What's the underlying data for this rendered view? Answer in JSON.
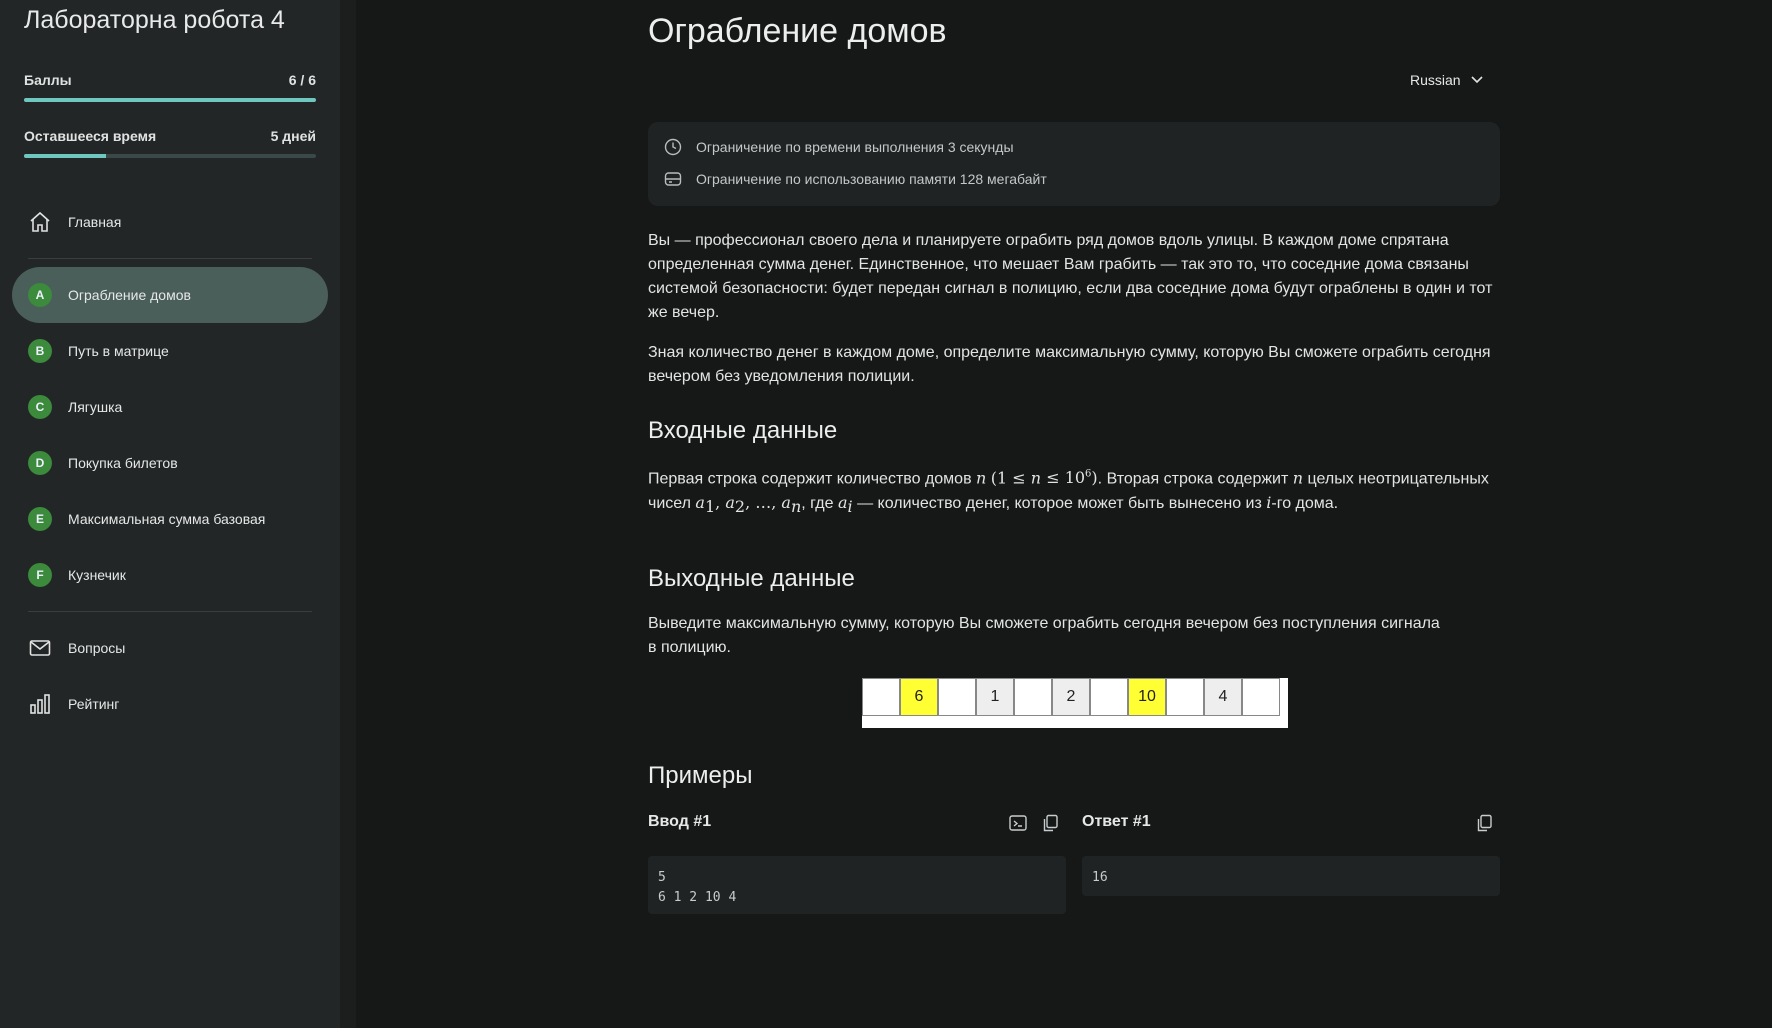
{
  "sidebar": {
    "title": "Лабораторна робота 4",
    "score_label": "Баллы",
    "score_value": "6 / 6",
    "score_fraction": 1.0,
    "time_label": "Оставшееся время",
    "time_value": "5 дней",
    "time_fraction": 0.28,
    "home_label": "Главная",
    "problems": [
      {
        "letter": "A",
        "label": "Ограбление домов",
        "active": true
      },
      {
        "letter": "B",
        "label": "Путь в матрице",
        "active": false
      },
      {
        "letter": "C",
        "label": "Лягушка",
        "active": false
      },
      {
        "letter": "D",
        "label": "Покупка билетов",
        "active": false
      },
      {
        "letter": "E",
        "label": "Максимальная сумма базовая",
        "active": false
      },
      {
        "letter": "F",
        "label": "Кузнечик",
        "active": false
      }
    ],
    "questions_label": "Вопросы",
    "rating_label": "Рейтинг"
  },
  "problem": {
    "title": "Ограбление домов",
    "language": "Russian",
    "time_limit": "Ограничение по времени выполнения 3 секунды",
    "memory_limit": "Ограничение по использованию памяти 128 мегабайт",
    "statement_1": "Вы — профессионал своего дела и планируете ограбить ряд домов вдоль улицы. В каждом доме спрятана определенная сумма денег. Единственное, что мешает Вам грабить — так это то, что соседние дома связаны системой безопасности: будет передан сигнал в полицию, если два соседние дома будут ограблены в один и тот же вечер.",
    "statement_2": "Зная количество денег в каждом доме, определите максимальную сумму, которую Вы сможете ограбить сегодня вечером без уведомления полиции.",
    "input_heading": "Входные данные",
    "input_text_1": "Первая строка содержит количество домов ",
    "input_text_2": ". Вторая строка содержит ",
    "input_text_3": " целых неотрицательных чисел ",
    "input_text_4": ", где ",
    "input_text_5": " — количество денег, которое может быть вынесено из ",
    "input_text_6": "-го дома.",
    "output_heading": "Выходные данные",
    "output_text": "Выведите максимальную сумму, которую Вы сможете ограбить сегодня вечером без поступления сигнала в полицию.",
    "houses": [
      {
        "value": "",
        "color": "white"
      },
      {
        "value": "6",
        "color": "yellow"
      },
      {
        "value": "",
        "color": "white"
      },
      {
        "value": "1",
        "color": "gray"
      },
      {
        "value": "",
        "color": "white"
      },
      {
        "value": "2",
        "color": "gray"
      },
      {
        "value": "",
        "color": "white"
      },
      {
        "value": "10",
        "color": "yellow"
      },
      {
        "value": "",
        "color": "white"
      },
      {
        "value": "4",
        "color": "gray"
      },
      {
        "value": "",
        "color": "white"
      }
    ],
    "examples_heading": "Примеры",
    "example_input_label": "Ввод #1",
    "example_input": "5\n6 1 2 10 4",
    "example_output_label": "Ответ #1",
    "example_output": "16"
  },
  "colors": {
    "accent": "#6ec8c0",
    "badge": "#3c8a3c",
    "active_nav": "#4a5e5a"
  }
}
